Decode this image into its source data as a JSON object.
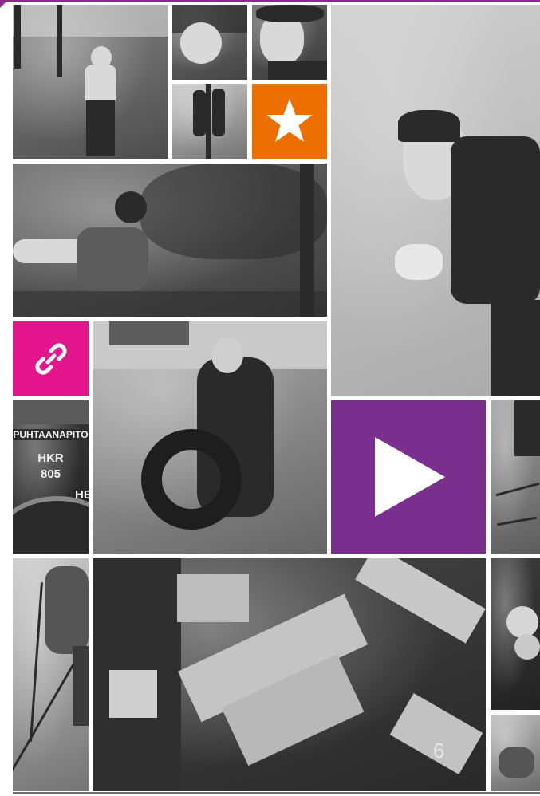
{
  "tiles": {
    "sign": {
      "line1": "PUHTAANAPITO",
      "line2": "HKR",
      "line3": "805",
      "line4": "HE"
    }
  },
  "icons": {
    "star": "star-icon",
    "link": "link-icon",
    "play": "play-icon"
  },
  "colors": {
    "star_tile": "#ec6f00",
    "link_tile": "#e4168d",
    "play_tile": "#7a2f8f",
    "accent_line": "#8a2a8f"
  },
  "page_number": "6"
}
